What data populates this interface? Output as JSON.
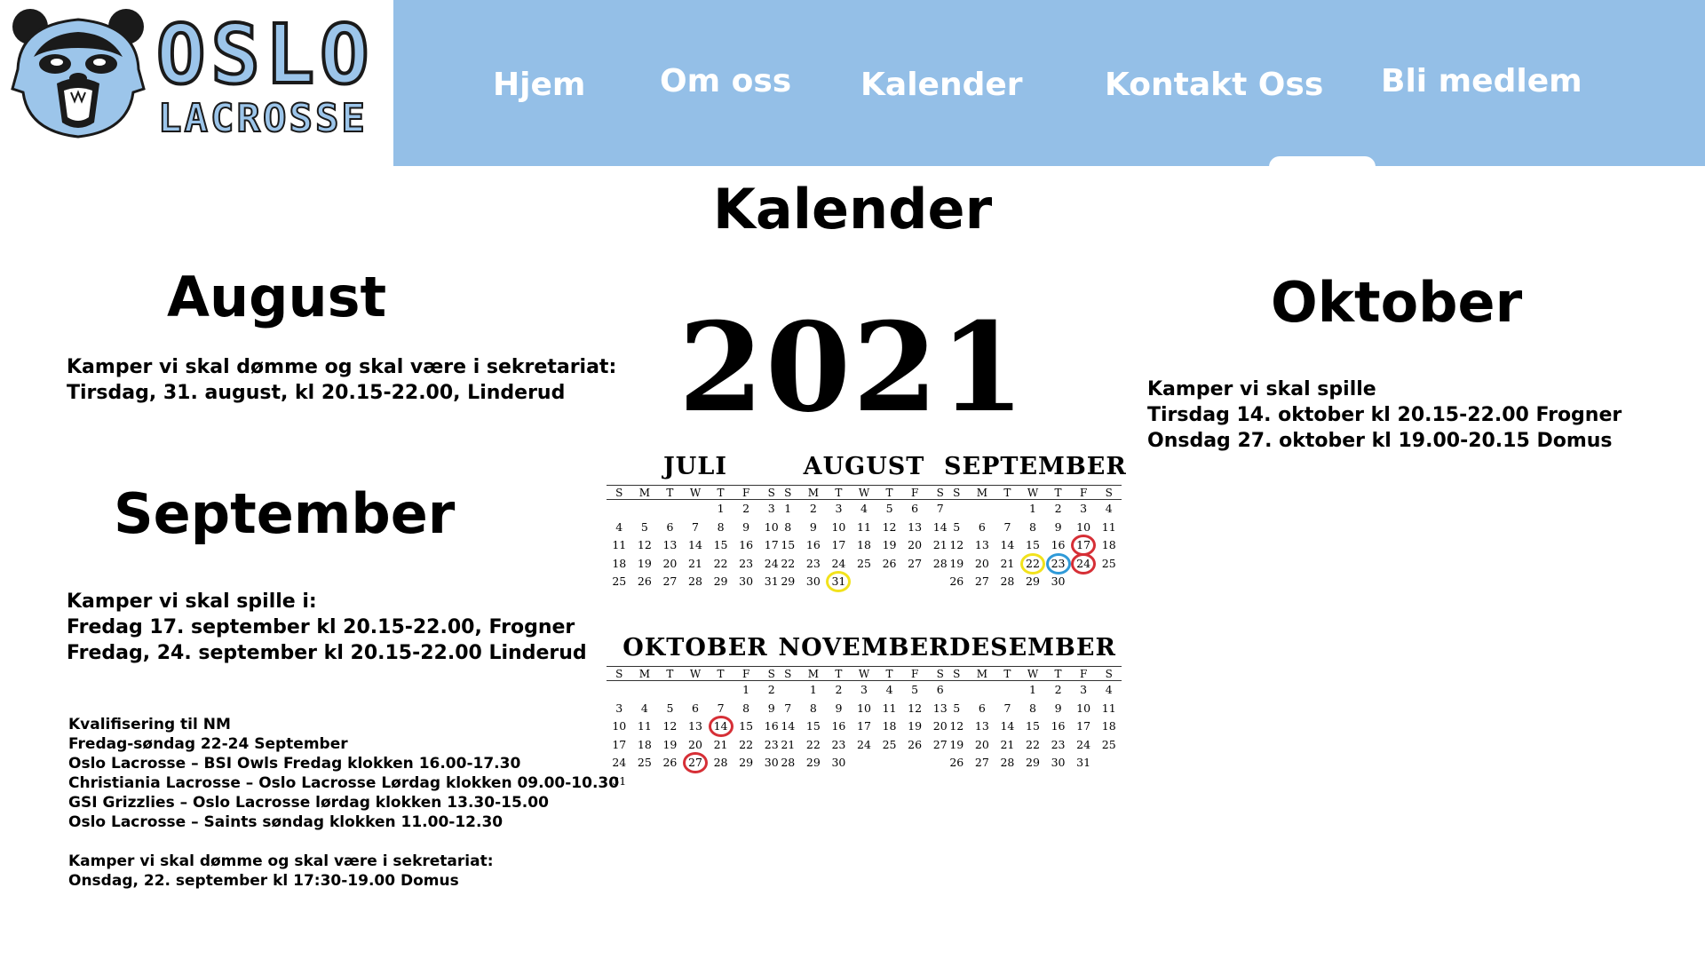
{
  "brand": {
    "name_main": "OSLO",
    "name_sub": "LACROSSE",
    "colors": {
      "nav_bg": "#94bfe7",
      "logo_blue": "#9cc5ea",
      "ring_red": "#d62f36",
      "ring_yellow": "#f2e21c",
      "ring_blue": "#2f9ad8"
    }
  },
  "nav": {
    "items": [
      {
        "label": "Hjem",
        "active": false
      },
      {
        "label": "Om oss",
        "active": false
      },
      {
        "label": "Kalender",
        "active": true
      },
      {
        "label": "Kontakt Oss",
        "active": false
      },
      {
        "label": "Bli medlem",
        "active": false
      }
    ]
  },
  "page": {
    "title": "Kalender"
  },
  "august": {
    "heading": "August",
    "lines": [
      "Kamper vi skal dømme og skal være i sekretariat:",
      "Tirsdag, 31. august, kl 20.15-22.00, Linderud"
    ]
  },
  "september": {
    "heading": "September",
    "lines": [
      "Kamper vi skal spille i:",
      "Fredag 17. september kl 20.15-22.00, Frogner",
      "Fredag, 24. september kl 20.15-22.00 Linderud"
    ],
    "details": [
      "Kvalifisering til NM",
      "Fredag-søndag 22-24 September",
      "Oslo Lacrosse – BSI Owls Fredag klokken 16.00-17.30",
      "Christiania Lacrosse – Oslo Lacrosse Lørdag klokken 09.00-10.30",
      "GSI Grizzlies – Oslo Lacrosse lørdag klokken 13.30-15.00",
      "Oslo Lacrosse – Saints søndag klokken 11.00-12.30",
      "",
      "Kamper vi skal dømme og skal være i sekretariat:",
      "Onsdag, 22. september kl 17:30-19.00 Domus"
    ]
  },
  "oktober": {
    "heading": "Oktober",
    "lines": [
      "Kamper vi skal spille",
      "Tirsdag 14. oktober kl 20.15-22.00 Frogner",
      "Onsdag 27. oktober kl 19.00-20.15 Domus"
    ]
  },
  "calendar": {
    "year": "2021",
    "weekdays": [
      "S",
      "M",
      "T",
      "W",
      "T",
      "F",
      "S"
    ],
    "months": [
      {
        "name": "JULI",
        "start": 4,
        "days": 31,
        "marks": []
      },
      {
        "name": "AUGUST",
        "start": 0,
        "days": 31,
        "marks": [
          {
            "day": 31,
            "color": "yellow"
          }
        ]
      },
      {
        "name": "SEPTEMBER",
        "start": 3,
        "days": 30,
        "marks": [
          {
            "day": 17,
            "color": "red"
          },
          {
            "day": 22,
            "color": "yellow"
          },
          {
            "day": 23,
            "color": "blue"
          },
          {
            "day": 24,
            "color": "red"
          }
        ]
      },
      {
        "name": "OKTOBER",
        "start": 5,
        "days": 31,
        "marks": [
          {
            "day": 14,
            "color": "red"
          },
          {
            "day": 27,
            "color": "red"
          }
        ]
      },
      {
        "name": "NOVEMBER",
        "start": 1,
        "days": 30,
        "marks": []
      },
      {
        "name": "DESEMBER",
        "start": 3,
        "days": 31,
        "marks": []
      }
    ]
  }
}
